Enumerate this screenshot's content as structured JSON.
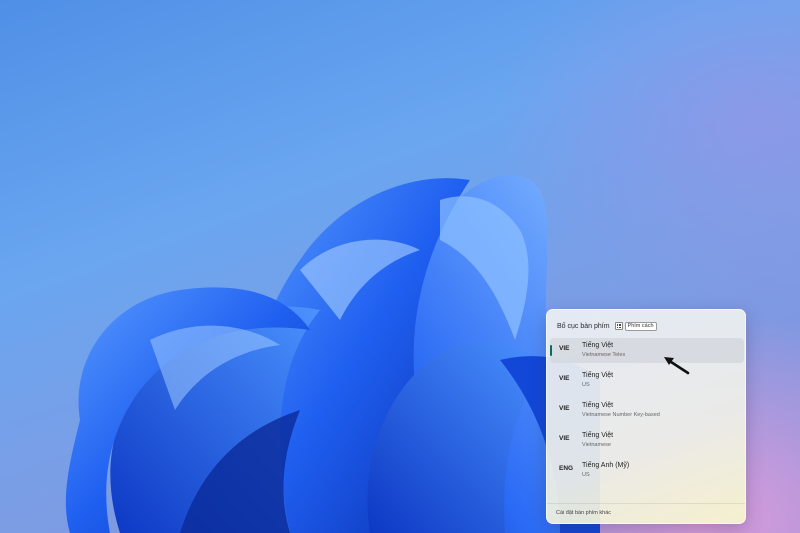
{
  "flyout": {
    "title": "Bố cục bàn phím",
    "hotkey_icon": "windows-key-icon",
    "hotkey_label": "Phím cách",
    "items": [
      {
        "code": "VIE",
        "name": "Tiếng Việt",
        "layout": "Vietnamese Telex",
        "selected": true
      },
      {
        "code": "VIE",
        "name": "Tiếng Việt",
        "layout": "US",
        "selected": false
      },
      {
        "code": "VIE",
        "name": "Tiếng Việt",
        "layout": "Vietnamese Number Key-based",
        "selected": false
      },
      {
        "code": "VIE",
        "name": "Tiếng Việt",
        "layout": "Vietnamese",
        "selected": false
      },
      {
        "code": "ENG",
        "name": "Tiếng Anh (Mỹ)",
        "layout": "US",
        "selected": false
      }
    ],
    "footer_link": "Cài đặt bàn phím khác"
  },
  "colors": {
    "selection_indicator": "#0b6b5a",
    "bloom_blue": "#1f5ff0",
    "annotation_arrow": "#111111"
  },
  "annotation": {
    "icon": "arrow-pointer-icon"
  }
}
